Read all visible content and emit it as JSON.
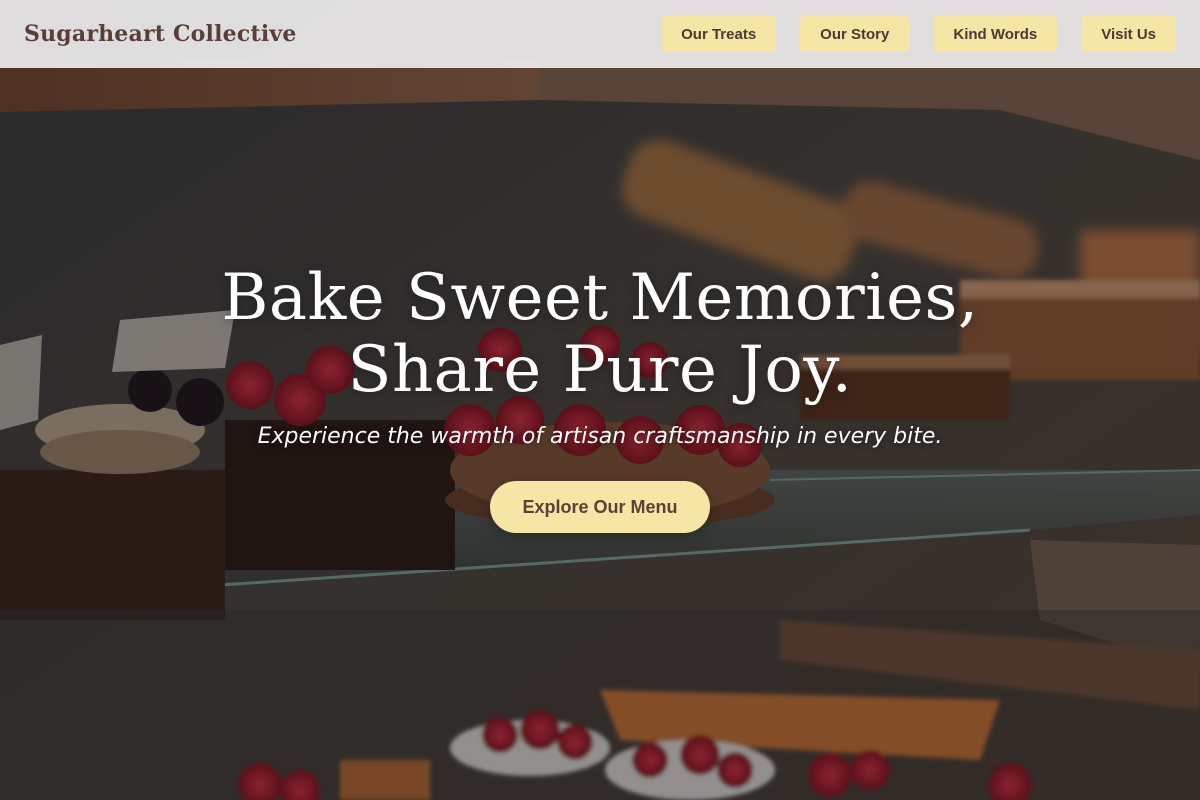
{
  "header": {
    "brand": "Sugarheart Collective",
    "nav": [
      {
        "label": "Our Treats"
      },
      {
        "label": "Our Story"
      },
      {
        "label": "Kind Words"
      },
      {
        "label": "Visit Us"
      }
    ]
  },
  "hero": {
    "headline_line1": "Bake Sweet Memories,",
    "headline_line2": "Share Pure Joy.",
    "tagline": "Experience the warmth of artisan craftsmanship in every bite.",
    "cta_label": "Explore Our Menu"
  },
  "colors": {
    "nav_bg": "#eeecec",
    "brand_text": "#5a3f38",
    "button_bg": "#f5e6a6",
    "button_text": "#4a3a32",
    "hero_text": "#ffffff"
  }
}
